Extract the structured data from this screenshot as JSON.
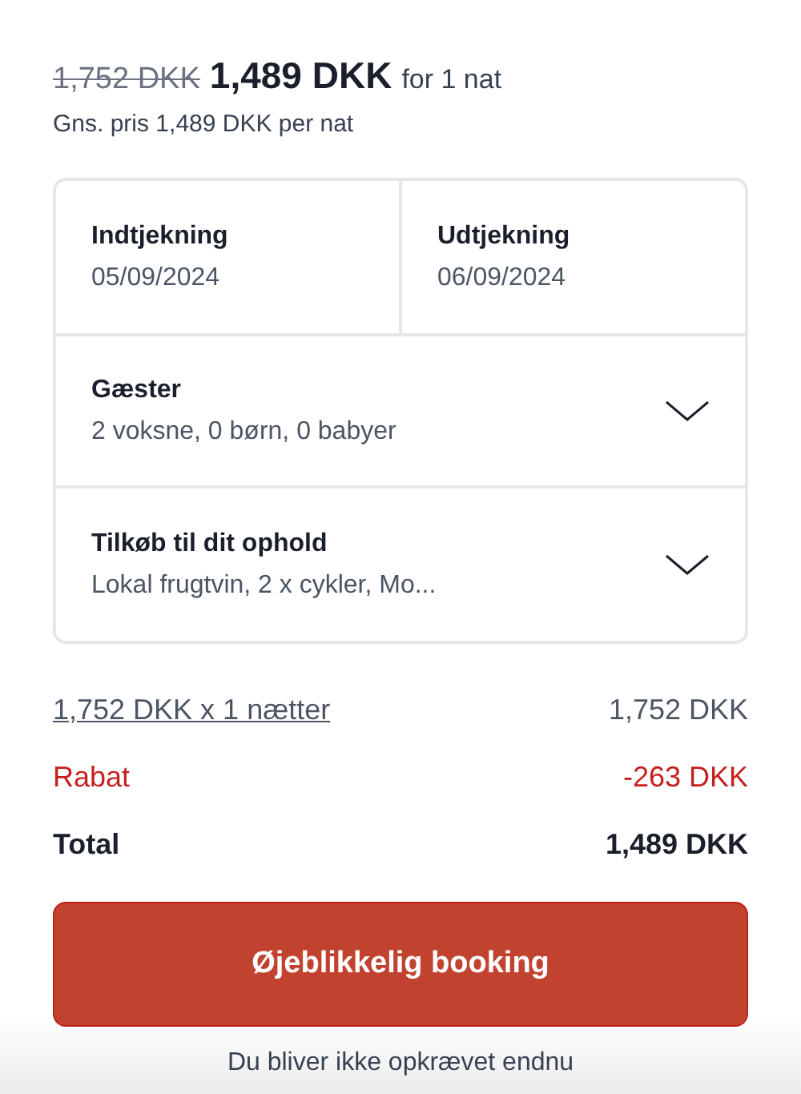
{
  "price": {
    "original": "1,752 DKK",
    "current": "1,489 DKK",
    "period": "for 1 nat",
    "average": "Gns. pris 1,489 DKK per nat"
  },
  "dates": [
    {
      "label": "Indtjekning",
      "value": "05/09/2024"
    },
    {
      "label": "Udtjekning",
      "value": "06/09/2024"
    }
  ],
  "sections": [
    {
      "label": "Gæster",
      "value": "2 voksne, 0 børn, 0 babyer",
      "expanded": false
    },
    {
      "label": "Tilkøb til dit ophold",
      "value": "Lokal frugtvin, 2 x cykler, Mo...",
      "expanded": false
    }
  ],
  "lines": [
    {
      "kind": "link",
      "label": "1,752 DKK x 1 nætter",
      "amount": "1,752 DKK"
    },
    {
      "kind": "discount",
      "label": "Rabat",
      "amount": "-263 DKK"
    },
    {
      "kind": "total",
      "label": "Total",
      "amount": "1,489 DKK"
    }
  ],
  "button": "Øjeblikkelig booking",
  "note": "Du bliver ikke opkrævet endnu"
}
